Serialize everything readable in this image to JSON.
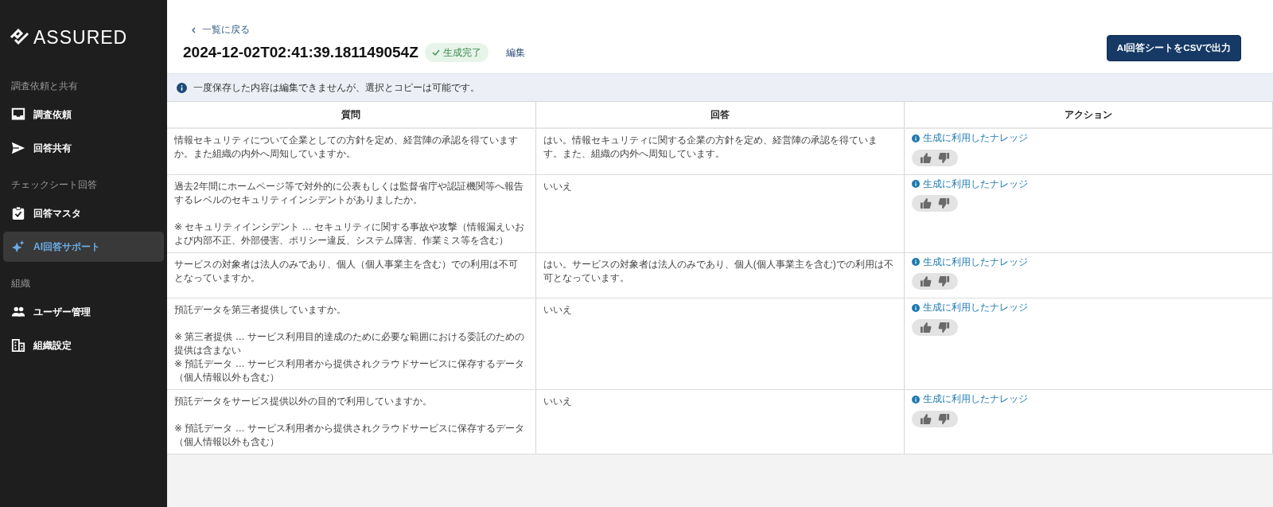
{
  "sidebar": {
    "logo": "ASSURED",
    "sections": [
      {
        "label": "調査依頼と共有",
        "items": [
          {
            "label": "調査依頼",
            "kind": "inbox",
            "selected": false
          },
          {
            "label": "回答共有",
            "kind": "send",
            "selected": false
          }
        ]
      },
      {
        "label": "チェックシート回答",
        "items": [
          {
            "label": "回答マスタ",
            "kind": "clipboard",
            "selected": false
          },
          {
            "label": "AI回答サポート",
            "kind": "sparkle",
            "selected": true
          }
        ]
      },
      {
        "label": "組織",
        "items": [
          {
            "label": "ユーザー管理",
            "kind": "people",
            "selected": false
          },
          {
            "label": "組織設定",
            "kind": "building",
            "selected": false
          }
        ]
      }
    ]
  },
  "header": {
    "back_link": "一覧に戻る",
    "title": "2024-12-02T02:41:39.181149054Z",
    "status_badge": "生成完了",
    "edit_link": "編集",
    "export_button": "AI回答シートをCSVで出力"
  },
  "notice": "一度保存した内容は編集できませんが、選択とコピーは可能です。",
  "table": {
    "columns": [
      "質問",
      "回答",
      "アクション"
    ],
    "rows": [
      {
        "question": "情報セキュリティについて企業としての方針を定め、経営陣の承認を得ていますか。また組織の内外へ周知していますか。",
        "answer": "はい。情報セキュリティに関する企業の方針を定め、経営陣の承認を得ています。また、組織の内外へ周知しています。",
        "knowledge_link": "生成に利用したナレッジ"
      },
      {
        "question": "過去2年間にホームページ等で対外的に公表もしくは監督省庁や認証機関等へ報告するレベルのセキュリティインシデントがありましたか。\n\n※ セキュリティインシデント … セキュリティに関する事故や攻撃（情報漏えいおよび内部不正、外部侵害、ポリシー違反、システム障害、作業ミス等を含む）",
        "answer": "いいえ",
        "knowledge_link": "生成に利用したナレッジ"
      },
      {
        "question": "サービスの対象者は法人のみであり、個人（個人事業主を含む）での利用は不可となっていますか。",
        "answer": "はい。サービスの対象者は法人のみであり、個人(個人事業主を含む)での利用は不可となっています。",
        "knowledge_link": "生成に利用したナレッジ"
      },
      {
        "question": "預託データを第三者提供していますか。\n\n※ 第三者提供 … サービス利用目的達成のために必要な範囲における委託のための提供は含まない\n※ 預託データ … サービス利用者から提供されクラウドサービスに保存するデータ（個人情報以外も含む）",
        "answer": "いいえ",
        "knowledge_link": "生成に利用したナレッジ"
      },
      {
        "question": "預託データをサービス提供以外の目的で利用していますか。\n\n※ 預託データ … サービス利用者から提供されクラウドサービスに保存するデータ（個人情報以外も含む）",
        "answer": "いいえ",
        "knowledge_link": "生成に利用したナレッジ"
      }
    ]
  }
}
